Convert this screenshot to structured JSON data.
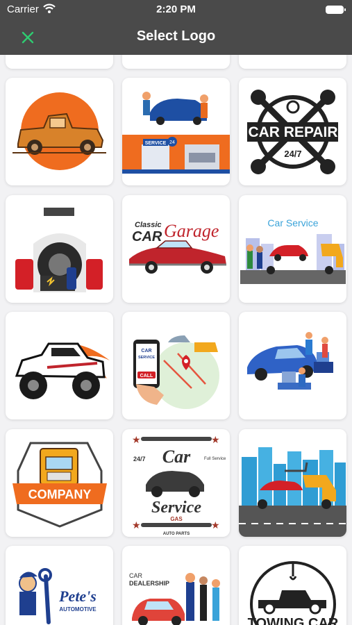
{
  "status_bar": {
    "carrier": "Carrier",
    "time": "2:20 PM"
  },
  "nav": {
    "title": "Select Logo"
  },
  "logos": {
    "car_garage": {
      "line1": "Classic",
      "line2": "CAR",
      "line3": "Garage"
    },
    "car_service_sign": {
      "label": "Car Service"
    },
    "car_repair": {
      "line1": "CAR REPAIR",
      "line2": "24/7"
    },
    "service_station": {
      "sign": "SERVICE",
      "badge": "24"
    },
    "car_service_badge": {
      "line1": "Car",
      "line2": "Service",
      "line3": "GAS",
      "line4": "AUTO PARTS",
      "tag1": "24/7",
      "tag2": "Full Service"
    },
    "company": {
      "label": "COMPANY"
    },
    "phone_app": {
      "line1": "CAR",
      "line2": "SERVICE",
      "line3": "CALL"
    },
    "petes": {
      "line1": "Pete's",
      "line2": "AUTOMOTIVE"
    },
    "dealership": {
      "line1": "CAR",
      "line2": "DEALERSHIP"
    },
    "towing": {
      "label": "TOWING CAR"
    }
  },
  "colors": {
    "bar": "#4a4a4a",
    "close": "#2ecc71",
    "orange": "#ef6c1f",
    "navy": "#1f3f8f",
    "red": "#d32027"
  }
}
